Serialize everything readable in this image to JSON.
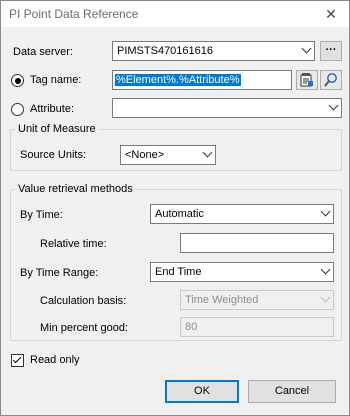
{
  "window": {
    "title": "PI Point Data Reference",
    "close_glyph": "✕"
  },
  "data_server": {
    "label": "Data server:",
    "value": "PIMSTS470161616",
    "browse_label": "···"
  },
  "tag_name": {
    "label": "Tag name:",
    "value": "%Element%.%Attribute%",
    "selected": true
  },
  "attribute": {
    "label": "Attribute:",
    "value": "",
    "selected": false
  },
  "unit_of_measure": {
    "group_title": "Unit of Measure",
    "source_units_label": "Source Units:",
    "source_units_value": "<None>"
  },
  "value_retrieval": {
    "group_title": "Value retrieval methods",
    "by_time_label": "By Time:",
    "by_time_value": "Automatic",
    "relative_time_label": "Relative time:",
    "relative_time_value": "",
    "by_time_range_label": "By Time Range:",
    "by_time_range_value": "End Time",
    "calc_basis_label": "Calculation basis:",
    "calc_basis_value": "Time Weighted",
    "min_percent_label": "Min percent good:",
    "min_percent_value": "80"
  },
  "read_only": {
    "label": "Read only",
    "checked": true
  },
  "buttons": {
    "ok": "OK",
    "cancel": "Cancel"
  },
  "icons": {
    "tag_properties": "tag-properties-icon",
    "search": "search-icon"
  },
  "colors": {
    "selection": "#0078d7",
    "default_button_border": "#0078d7"
  }
}
